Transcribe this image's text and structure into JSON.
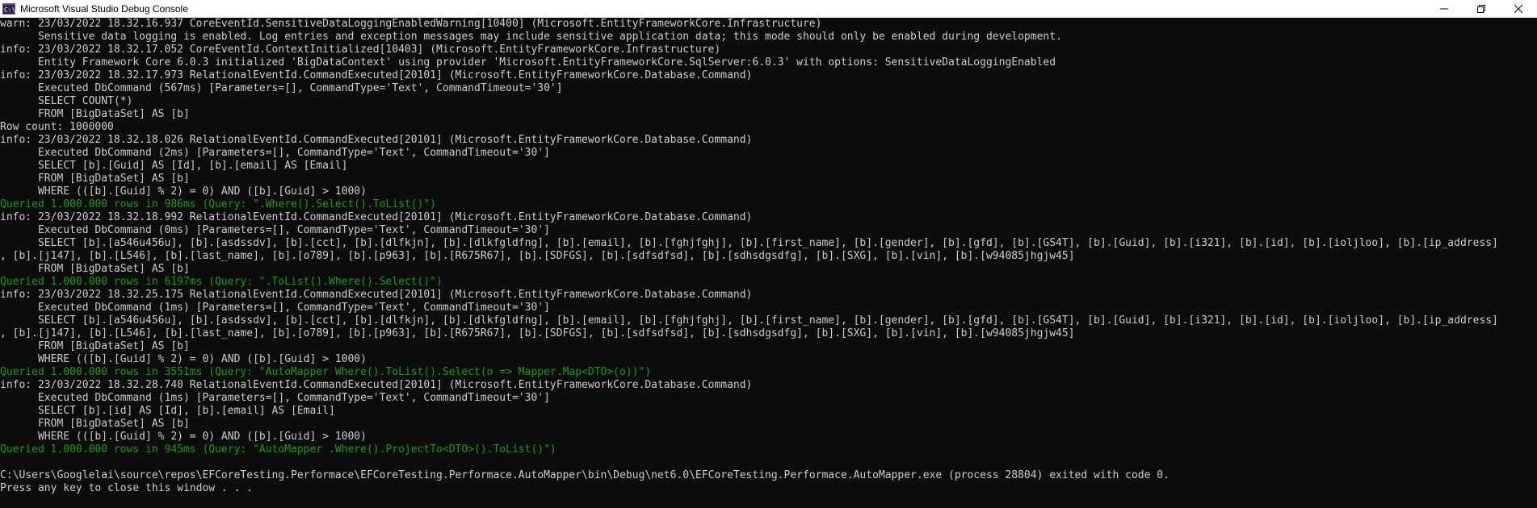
{
  "window": {
    "title": "Microsoft Visual Studio Debug Console",
    "icon": "visual-studio-console-icon",
    "controls": [
      "minimize-icon",
      "maximize-icon",
      "close-icon"
    ]
  },
  "colors": {
    "background": "#0c0c0c",
    "text": "#cccccc",
    "query_result": "#13a10e",
    "titlebar": "#ffffff"
  },
  "console": {
    "lines": [
      {
        "text": "warn: 23/03/2022 18.32.16.937 CoreEventId.SensitiveDataLoggingEnabledWarning[10400] (Microsoft.EntityFrameworkCore.Infrastructure)",
        "type": "log"
      },
      {
        "text": "      Sensitive data logging is enabled. Log entries and exception messages may include sensitive application data; this mode should only be enabled during development.",
        "type": "log"
      },
      {
        "text": "info: 23/03/2022 18.32.17.052 CoreEventId.ContextInitialized[10403] (Microsoft.EntityFrameworkCore.Infrastructure)",
        "type": "log"
      },
      {
        "text": "      Entity Framework Core 6.0.3 initialized 'BigDataContext' using provider 'Microsoft.EntityFrameworkCore.SqlServer:6.0.3' with options: SensitiveDataLoggingEnabled",
        "type": "log"
      },
      {
        "text": "info: 23/03/2022 18.32.17.973 RelationalEventId.CommandExecuted[20101] (Microsoft.EntityFrameworkCore.Database.Command)",
        "type": "log"
      },
      {
        "text": "      Executed DbCommand (567ms) [Parameters=[], CommandType='Text', CommandTimeout='30']",
        "type": "log"
      },
      {
        "text": "      SELECT COUNT(*)",
        "type": "log"
      },
      {
        "text": "      FROM [BigDataSet] AS [b]",
        "type": "log"
      },
      {
        "text": "Row count: 1000000",
        "type": "log"
      },
      {
        "text": "info: 23/03/2022 18.32.18.026 RelationalEventId.CommandExecuted[20101] (Microsoft.EntityFrameworkCore.Database.Command)",
        "type": "log"
      },
      {
        "text": "      Executed DbCommand (2ms) [Parameters=[], CommandType='Text', CommandTimeout='30']",
        "type": "log"
      },
      {
        "text": "      SELECT [b].[Guid] AS [Id], [b].[email] AS [Email]",
        "type": "log"
      },
      {
        "text": "      FROM [BigDataSet] AS [b]",
        "type": "log"
      },
      {
        "text": "      WHERE (([b].[Guid] % 2) = 0) AND ([b].[Guid] > 1000)",
        "type": "log"
      },
      {
        "text": "Queried 1.000.000 rows in 986ms (Query: \".Where().Select().ToList()\")",
        "type": "query"
      },
      {
        "text": "info: 23/03/2022 18.32.18.992 RelationalEventId.CommandExecuted[20101] (Microsoft.EntityFrameworkCore.Database.Command)",
        "type": "log"
      },
      {
        "text": "      Executed DbCommand (0ms) [Parameters=[], CommandType='Text', CommandTimeout='30']",
        "type": "log"
      },
      {
        "text": "      SELECT [b].[a546u456u], [b].[asdssdv], [b].[cct], [b].[dlfkjn], [b].[dlkfgldfng], [b].[email], [b].[fghjfghj], [b].[first_name], [b].[gender], [b].[gfd], [b].[GS4T], [b].[Guid], [b].[i321], [b].[id], [b].[ioljloo], [b].[ip_address]",
        "type": "log"
      },
      {
        "text": ", [b].[j147], [b].[L546], [b].[last_name], [b].[o789], [b].[p963], [b].[R675R67], [b].[SDFGS], [b].[sdfsdfsd], [b].[sdhsdgsdfg], [b].[SXG], [b].[vin], [b].[w94085jhgjw45]",
        "type": "log"
      },
      {
        "text": "      FROM [BigDataSet] AS [b]",
        "type": "log"
      },
      {
        "text": "Queried 1.000.000 rows in 6197ms (Query: \".ToList().Where().Select()\")",
        "type": "query"
      },
      {
        "text": "info: 23/03/2022 18.32.25.175 RelationalEventId.CommandExecuted[20101] (Microsoft.EntityFrameworkCore.Database.Command)",
        "type": "log"
      },
      {
        "text": "      Executed DbCommand (1ms) [Parameters=[], CommandType='Text', CommandTimeout='30']",
        "type": "log"
      },
      {
        "text": "      SELECT [b].[a546u456u], [b].[asdssdv], [b].[cct], [b].[dlfkjn], [b].[dlkfgldfng], [b].[email], [b].[fghjfghj], [b].[first_name], [b].[gender], [b].[gfd], [b].[GS4T], [b].[Guid], [b].[i321], [b].[id], [b].[ioljloo], [b].[ip_address]",
        "type": "log"
      },
      {
        "text": ", [b].[j147], [b].[L546], [b].[last_name], [b].[o789], [b].[p963], [b].[R675R67], [b].[SDFGS], [b].[sdfsdfsd], [b].[sdhsdgsdfg], [b].[SXG], [b].[vin], [b].[w94085jhgjw45]",
        "type": "log"
      },
      {
        "text": "      FROM [BigDataSet] AS [b]",
        "type": "log"
      },
      {
        "text": "      WHERE (([b].[Guid] % 2) = 0) AND ([b].[Guid] > 1000)",
        "type": "log"
      },
      {
        "text": "Queried 1.000.000 rows in 3551ms (Query: \"AutoMapper Where().ToList().Select(o => Mapper.Map<DTO>(o))\")",
        "type": "query"
      },
      {
        "text": "info: 23/03/2022 18.32.28.740 RelationalEventId.CommandExecuted[20101] (Microsoft.EntityFrameworkCore.Database.Command)",
        "type": "log"
      },
      {
        "text": "      Executed DbCommand (1ms) [Parameters=[], CommandType='Text', CommandTimeout='30']",
        "type": "log"
      },
      {
        "text": "      SELECT [b].[id] AS [Id], [b].[email] AS [Email]",
        "type": "log"
      },
      {
        "text": "      FROM [BigDataSet] AS [b]",
        "type": "log"
      },
      {
        "text": "      WHERE (([b].[Guid] % 2) = 0) AND ([b].[Guid] > 1000)",
        "type": "log"
      },
      {
        "text": "Queried 1.000.000 rows in 945ms (Query: \"AutoMapper .Where().ProjectTo<DTO>().ToList()\")",
        "type": "query"
      },
      {
        "text": "",
        "type": "log"
      },
      {
        "text": "C:\\Users\\Googlelai\\source\\repos\\EFCoreTesting.Performace\\EFCoreTesting.Performace.AutoMapper\\bin\\Debug\\net6.0\\EFCoreTesting.Performace.AutoMapper.exe (process 28804) exited with code 0.",
        "type": "log"
      },
      {
        "text": "Press any key to close this window . . .",
        "type": "log"
      }
    ]
  }
}
